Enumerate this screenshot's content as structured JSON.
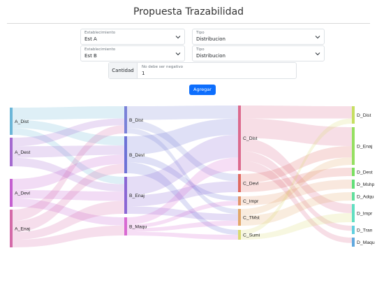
{
  "header": {
    "title": "Propuesta Trazabilidad"
  },
  "form": {
    "origin": {
      "establishment": {
        "label": "Establecimiento",
        "value": "Est A"
      },
      "type": {
        "label": "Tipo",
        "value": "Distribucion"
      }
    },
    "destination": {
      "establishment": {
        "label": "Establecimiento",
        "value": "Est B"
      },
      "type": {
        "label": "Tipo",
        "value": "Distribucion"
      }
    },
    "quantity": {
      "addon": "Cantidad",
      "label": "No debe ser negativo",
      "value": "1"
    },
    "add_button": "Agregar"
  },
  "sankey": {
    "columns": [
      [
        {
          "name": "A_Dist",
          "color": "#6bb6d8"
        },
        {
          "name": "A_Dest",
          "color": "#a46ad0"
        },
        {
          "name": "A_Devl",
          "color": "#c45fd0"
        },
        {
          "name": "A_Enaj",
          "color": "#d46aa8"
        }
      ],
      [
        {
          "name": "B_Dist",
          "color": "#7a82d8"
        },
        {
          "name": "B_Devl",
          "color": "#6d72d6"
        },
        {
          "name": "B_Enaj",
          "color": "#8a66d4"
        },
        {
          "name": "B_Maqu",
          "color": "#d86ad2"
        }
      ],
      [
        {
          "name": "C_Dist",
          "color": "#dc6a8e"
        },
        {
          "name": "C_Devl",
          "color": "#df6a62"
        },
        {
          "name": "C_Impr",
          "color": "#e2956a"
        },
        {
          "name": "C_TMst",
          "color": "#e2a86a"
        },
        {
          "name": "C_Sumi",
          "color": "#dada72"
        }
      ],
      [
        {
          "name": "D_Dist",
          "color": "#c6df62"
        },
        {
          "name": "D_Enaj",
          "color": "#96df62"
        },
        {
          "name": "D_Dest",
          "color": "#7bdf62"
        },
        {
          "name": "D_Mshp",
          "color": "#62df7a"
        },
        {
          "name": "D_Adqu",
          "color": "#62df9e"
        },
        {
          "name": "D_Impr",
          "color": "#62dfc2"
        },
        {
          "name": "D_Tran",
          "color": "#62d0df"
        },
        {
          "name": "D_Maqu",
          "color": "#62a9df"
        }
      ]
    ]
  }
}
